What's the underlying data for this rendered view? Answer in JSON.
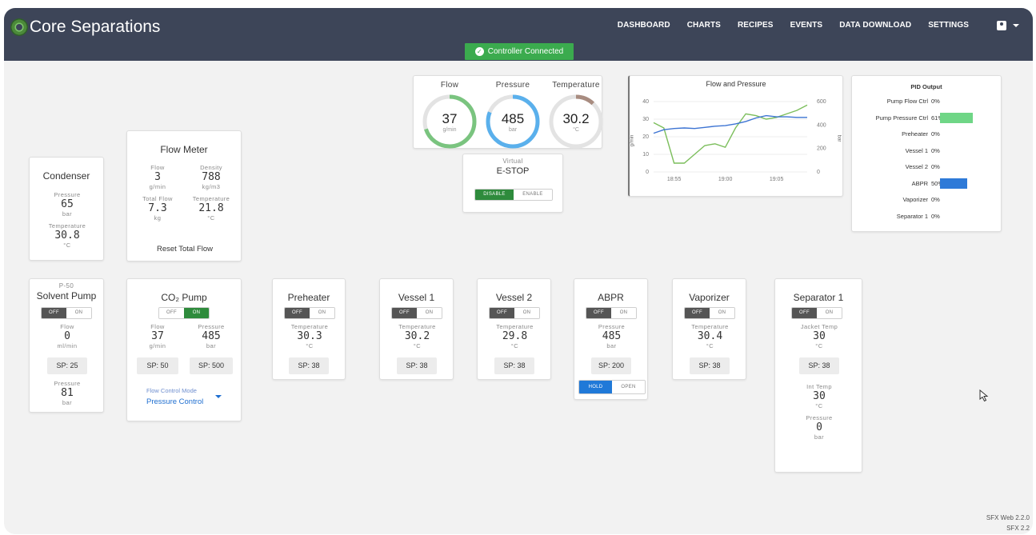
{
  "app": {
    "logo": "Core Separations"
  },
  "nav": [
    "DASHBOARD",
    "CHARTS",
    "RECIPES",
    "EVENTS",
    "DATA DOWNLOAD",
    "SETTINGS"
  ],
  "status": {
    "connected": "Controller Connected"
  },
  "gauges": [
    {
      "name": "Flow",
      "value": "37",
      "unit": "g/min",
      "fraction": 0.7,
      "color": "#7ac47f"
    },
    {
      "name": "Pressure",
      "value": "485",
      "unit": "bar",
      "fraction": 0.81,
      "color": "#5ab0ec"
    },
    {
      "name": "Temperature",
      "value": "30.2",
      "unit": "°C",
      "fraction": 0.12,
      "color": "#a88c80"
    }
  ],
  "estop": {
    "label": "Virtual",
    "title": "E-STOP",
    "disable": "DISABLE",
    "enable": "ENABLE"
  },
  "chart": {
    "title": "Flow and Pressure",
    "left_axis_label": "g/min",
    "right_axis_label": "bar",
    "left_ticks": [
      "0",
      "10",
      "20",
      "30",
      "40"
    ],
    "right_ticks": [
      "0",
      "200",
      "400",
      "600"
    ],
    "x_ticks": [
      "18:55",
      "19:00",
      "19:05"
    ]
  },
  "chart_data": {
    "type": "line",
    "title": "Flow and Pressure",
    "xlabel": "",
    "ylabel": "g/min",
    "y2label": "bar",
    "x": [
      "18:53",
      "18:54",
      "18:55",
      "18:56",
      "18:57",
      "18:58",
      "18:59",
      "19:00",
      "19:01",
      "19:02",
      "19:03",
      "19:04",
      "19:05",
      "19:06",
      "19:07",
      "19:08"
    ],
    "ylim": [
      0,
      40
    ],
    "y2lim": [
      0,
      600
    ],
    "series": [
      {
        "axis": "left",
        "values": [
          28,
          25,
          5,
          5,
          10,
          15,
          16,
          14,
          25,
          33,
          32,
          30,
          31,
          33,
          35,
          38
        ]
      },
      {
        "axis": "right",
        "values": [
          330,
          360,
          370,
          375,
          370,
          380,
          390,
          395,
          410,
          430,
          460,
          480,
          470,
          470,
          465,
          465
        ]
      }
    ]
  },
  "pid": {
    "title": "PID Output",
    "rows": [
      {
        "name": "Pump Flow Ctrl",
        "value": "0%",
        "level": 0,
        "color": ""
      },
      {
        "name": "Pump Pressure Ctrl",
        "value": "61%",
        "level": 0.61,
        "color": "#6fd686"
      },
      {
        "name": "Preheater",
        "value": "0%",
        "level": 0,
        "color": ""
      },
      {
        "name": "Vessel 1",
        "value": "0%",
        "level": 0,
        "color": ""
      },
      {
        "name": "Vessel 2",
        "value": "0%",
        "level": 0,
        "color": ""
      },
      {
        "name": "ABPR",
        "value": "50%",
        "level": 0.5,
        "color": "#2e7ad8"
      },
      {
        "name": "Vaporizer",
        "value": "0%",
        "level": 0,
        "color": ""
      },
      {
        "name": "Separator 1",
        "value": "0%",
        "level": 0,
        "color": ""
      }
    ]
  },
  "condenser": {
    "title": "Condenser",
    "pressure_label": "Pressure",
    "pressure": "65",
    "pressure_unit": "bar",
    "temp_label": "Temperature",
    "temp": "30.8",
    "temp_unit": "°C"
  },
  "flowmeter": {
    "title": "Flow Meter",
    "flow_label": "Flow",
    "flow": "3",
    "flow_unit": "g/min",
    "density_label": "Density",
    "density": "788",
    "density_unit": "kg/m3",
    "total_label": "Total Flow",
    "total": "7.3",
    "total_unit": "kg",
    "temp_label": "Temperature",
    "temp": "21.8",
    "temp_unit": "°C",
    "reset": "Reset Total Flow"
  },
  "solvent_pump": {
    "subtitle": "P-50",
    "title": "Solvent Pump",
    "off": "OFF",
    "on": "ON",
    "flow_label": "Flow",
    "flow": "0",
    "flow_unit": "ml/min",
    "sp": "SP: 25",
    "pressure_label": "Pressure",
    "pressure": "81",
    "pressure_unit": "bar"
  },
  "co2_pump": {
    "title": "CO₂ Pump",
    "off": "OFF",
    "on": "ON",
    "flow_label": "Flow",
    "flow": "37",
    "flow_unit": "g/min",
    "pressure_label": "Pressure",
    "pressure": "485",
    "pressure_unit": "bar",
    "sp_flow": "SP: 50",
    "sp_pressure": "SP: 500",
    "mode_label": "Flow Control Mode",
    "mode": "Pressure Control"
  },
  "preheater": {
    "title": "Preheater",
    "off": "OFF",
    "on": "ON",
    "label": "Temperature",
    "value": "30.3",
    "unit": "°C",
    "sp": "SP: 38"
  },
  "vessel1": {
    "title": "Vessel 1",
    "off": "OFF",
    "on": "ON",
    "label": "Temperature",
    "value": "30.2",
    "unit": "°C",
    "sp": "SP: 38"
  },
  "vessel2": {
    "title": "Vessel 2",
    "off": "OFF",
    "on": "ON",
    "label": "Temperature",
    "value": "29.8",
    "unit": "°C",
    "sp": "SP: 38"
  },
  "abpr": {
    "title": "ABPR",
    "off": "OFF",
    "on": "ON",
    "label": "Pressure",
    "value": "485",
    "unit": "bar",
    "sp": "SP: 200",
    "hold": "HOLD",
    "open": "OPEN"
  },
  "vaporizer": {
    "title": "Vaporizer",
    "off": "OFF",
    "on": "ON",
    "label": "Temperature",
    "value": "30.4",
    "unit": "°C",
    "sp": "SP: 38"
  },
  "separator1": {
    "title": "Separator 1",
    "off": "OFF",
    "on": "ON",
    "jacket_label": "Jacket Temp",
    "jacket": "30",
    "jacket_unit": "°C",
    "sp": "SP: 38",
    "int_label": "Int Temp",
    "int": "30",
    "int_unit": "°C",
    "pressure_label": "Pressure",
    "pressure": "0",
    "pressure_unit": "bar"
  },
  "footer": {
    "line1": "SFX Web 2.2.0",
    "line2": "SFX 2.2"
  },
  "colors": {
    "topbar": "#3d4558",
    "connected": "#3bab4e",
    "toggle_on_gray": "#555555",
    "toggle_on_green": "#2e8b3c",
    "toggle_on_blue": "#2079d8"
  }
}
